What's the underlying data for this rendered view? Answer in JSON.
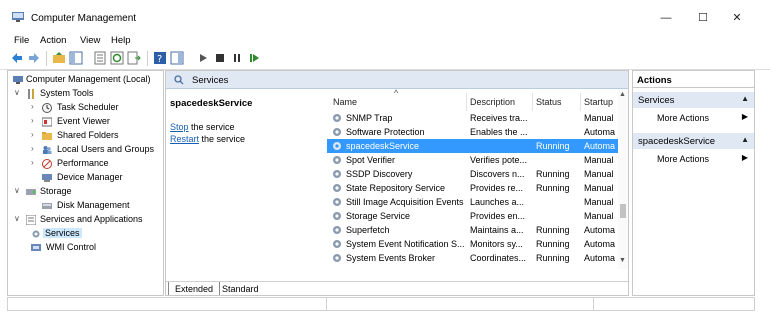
{
  "window": {
    "title": "Computer Management",
    "buttons": {
      "minimize": "—",
      "maximize": "☐",
      "close": "✕"
    }
  },
  "menu": [
    "File",
    "Action",
    "View",
    "Help"
  ],
  "tree": [
    {
      "label": "Computer Management (Local)",
      "icon": "computer-management-icon",
      "expander": ""
    },
    {
      "label": "System Tools",
      "icon": "tools-icon",
      "expander": "∨"
    },
    {
      "label": "Task Scheduler",
      "icon": "clock-icon",
      "expander": "›"
    },
    {
      "label": "Event Viewer",
      "icon": "event-viewer-icon",
      "expander": "›"
    },
    {
      "label": "Shared Folders",
      "icon": "folder-icon",
      "expander": "›"
    },
    {
      "label": "Local Users and Groups",
      "icon": "users-icon",
      "expander": "›"
    },
    {
      "label": "Performance",
      "icon": "performance-icon",
      "expander": "›"
    },
    {
      "label": "Device Manager",
      "icon": "device-manager-icon",
      "expander": ""
    },
    {
      "label": "Storage",
      "icon": "storage-icon",
      "expander": "∨"
    },
    {
      "label": "Disk Management",
      "icon": "disk-icon",
      "expander": ""
    },
    {
      "label": "Services and Applications",
      "icon": "services-apps-icon",
      "expander": "∨"
    },
    {
      "label": "Services",
      "icon": "gear-icon",
      "expander": ""
    },
    {
      "label": "WMI Control",
      "icon": "wmi-icon",
      "expander": ""
    }
  ],
  "center": {
    "header_title": "Services",
    "detail_title": "spacedeskService",
    "stop_link": "Stop",
    "stop_rest": " the service",
    "restart_link": "Restart",
    "restart_rest": " the service",
    "sort_indicator": "^",
    "columns": [
      "Name",
      "Description",
      "Status",
      "Startup"
    ],
    "rows": [
      {
        "name": "SNMP Trap",
        "description": "Receives tra...",
        "status": "",
        "startup": "Manual"
      },
      {
        "name": "Software Protection",
        "description": "Enables the ...",
        "status": "",
        "startup": "Automa"
      },
      {
        "name": "spacedeskService",
        "description": "",
        "status": "Running",
        "startup": "Automa",
        "selected": true
      },
      {
        "name": "Spot Verifier",
        "description": "Verifies pote...",
        "status": "",
        "startup": "Manual"
      },
      {
        "name": "SSDP Discovery",
        "description": "Discovers n...",
        "status": "Running",
        "startup": "Manual"
      },
      {
        "name": "State Repository Service",
        "description": "Provides re...",
        "status": "Running",
        "startup": "Manual"
      },
      {
        "name": "Still Image Acquisition Events",
        "description": "Launches a...",
        "status": "",
        "startup": "Manual"
      },
      {
        "name": "Storage Service",
        "description": "Provides en...",
        "status": "",
        "startup": "Manual"
      },
      {
        "name": "Superfetch",
        "description": "Maintains a...",
        "status": "Running",
        "startup": "Automa"
      },
      {
        "name": "System Event Notification S...",
        "description": "Monitors sy...",
        "status": "Running",
        "startup": "Automa"
      },
      {
        "name": "System Events Broker",
        "description": "Coordinates...",
        "status": "Running",
        "startup": "Automa"
      }
    ],
    "tabs": [
      "Extended",
      "Standard"
    ]
  },
  "actions": {
    "header": "Actions",
    "groups": [
      {
        "title": "Services",
        "arrow": "▲",
        "items": [
          {
            "label": "More Actions",
            "arrow": "▶"
          }
        ]
      },
      {
        "title": "spacedeskService",
        "arrow": "▲",
        "items": [
          {
            "label": "More Actions",
            "arrow": "▶"
          }
        ]
      }
    ]
  },
  "colors": {
    "selection": "#3399ff",
    "header_band": "#dfe8f3",
    "link": "#1a5fb4"
  }
}
